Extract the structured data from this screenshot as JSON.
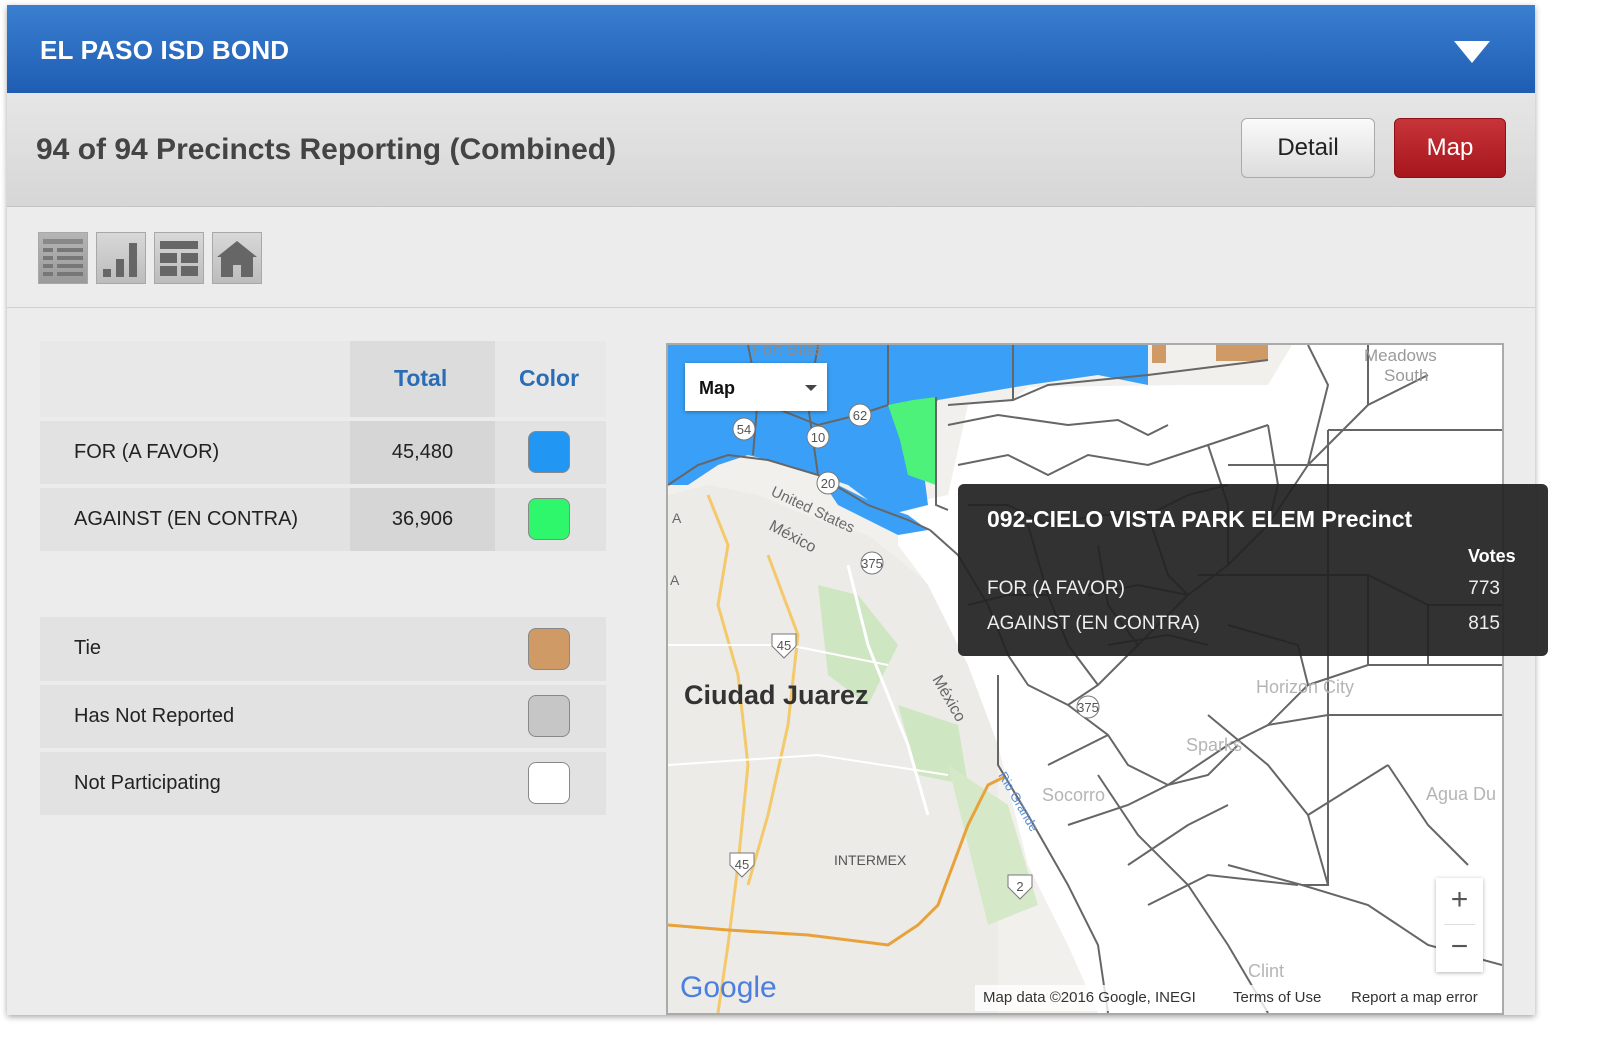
{
  "header": {
    "title": "EL PASO ISD BOND"
  },
  "status": {
    "text": "94 of 94 Precincts Reporting (Combined)",
    "detail_label": "Detail",
    "map_label": "Map"
  },
  "toolbar": {
    "icons": [
      "list-view-icon",
      "bar-chart-icon",
      "grid-view-icon",
      "home-icon"
    ]
  },
  "legend": {
    "col_total": "Total",
    "col_color": "Color",
    "results": [
      {
        "label": "FOR (A FAVOR)",
        "total": "45,480",
        "color": "#2196f3"
      },
      {
        "label": "AGAINST (EN CONTRA)",
        "total": "36,906",
        "color": "#2ef76b"
      }
    ],
    "keys": [
      {
        "label": "Tie",
        "color": "#cf9a66"
      },
      {
        "label": "Has Not Reported",
        "color": "#c6c6c6"
      },
      {
        "label": "Not Participating",
        "color": "#ffffff"
      }
    ]
  },
  "map": {
    "type_select": "Map",
    "place_labels": {
      "fort_bliss": "Fort Bliss",
      "meadows": "Meadows",
      "meadows_south": "South",
      "ciudad_juarez": "Ciudad Juarez",
      "mexico_1": "México",
      "mexico_2": "México",
      "united_states": "United States",
      "horizon_city": "Horizon City",
      "sparks": "Sparks",
      "socorro": "Socorro",
      "agua_dulce": "Agua Du",
      "intermex": "INTERMEX",
      "clint": "Clint",
      "rio_grande": "Rio Grande",
      "edge_a": "A",
      "edge_a2": "A"
    },
    "shields": [
      "62",
      "54",
      "10",
      "20",
      "375",
      "45",
      "45",
      "2",
      "375"
    ],
    "google_logo": "Google",
    "attribution": "Map data ©2016 Google, INEGI",
    "terms": "Terms of Use",
    "report": "Report a map error",
    "zoom_in": "+",
    "zoom_out": "−"
  },
  "tooltip": {
    "title": "092-CIELO VISTA PARK ELEM Precinct",
    "votes_header": "Votes",
    "rows": [
      {
        "label": "FOR (A FAVOR)",
        "value": "773"
      },
      {
        "label": "AGAINST (EN CONTRA)",
        "value": "815"
      }
    ]
  },
  "colors": {
    "header_blue": "#2a6bc4",
    "map_button_red": "#b3222a",
    "for_blue": "#2196f3",
    "against_green": "#2ef76b",
    "tie_tan": "#cf9a66"
  }
}
